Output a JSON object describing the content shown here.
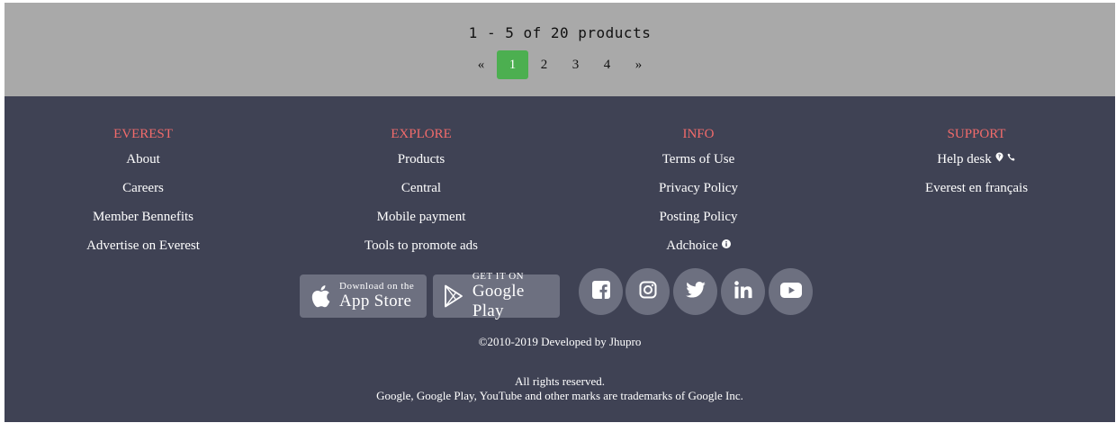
{
  "pagination": {
    "summary": "1 - 5 of 20 products",
    "prev": "«",
    "next": "»",
    "pages": [
      "1",
      "2",
      "3",
      "4"
    ],
    "current": "1"
  },
  "footer": {
    "columns": [
      {
        "title": "EVEREST",
        "links": [
          "About",
          "Careers",
          "Member Bennefits",
          "Advertise on Everest"
        ]
      },
      {
        "title": "EXPLORE",
        "links": [
          "Products",
          "Central",
          "Mobile payment",
          "Tools to promote ads"
        ]
      },
      {
        "title": "INFO",
        "links": [
          "Terms of Use",
          "Privacy Policy",
          "Posting Policy",
          "Adchoice"
        ]
      },
      {
        "title": "SUPPORT",
        "links": [
          "Help desk",
          "Everest en français"
        ]
      }
    ],
    "app_store": {
      "small": "Download on the",
      "big": "App Store"
    },
    "google_play": {
      "small": "GET IT ON",
      "big": "Google Play"
    },
    "social": [
      "facebook-icon",
      "instagram-icon",
      "twitter-icon",
      "linkedin-icon",
      "youtube-icon"
    ],
    "copyright": "©2010-2019 Developed by Jhupro",
    "rights": "All rights reserved.",
    "trademark": "Google, Google Play, YouTube and other marks are trademarks of Google Inc."
  },
  "colors": {
    "pager_bg": "#a9a9a9",
    "active_page": "#4caf50",
    "footer_bg": "#3f4254",
    "column_title": "#f26b6b",
    "badge_bg": "#6d7080"
  }
}
